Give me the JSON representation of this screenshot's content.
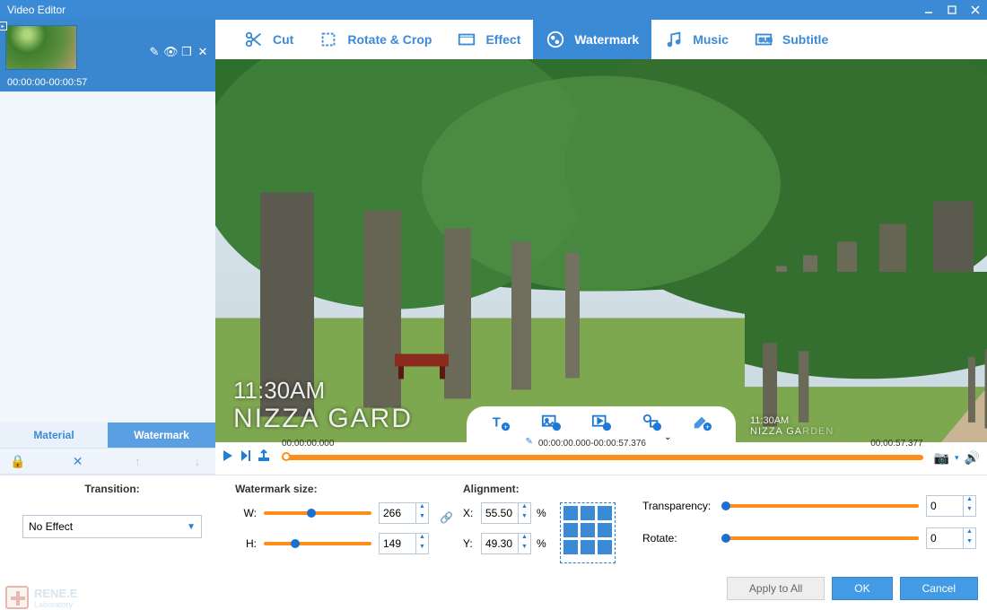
{
  "window": {
    "title": "Video Editor"
  },
  "clip": {
    "time": "00:00:00-00:00:57"
  },
  "sidebarTabs": {
    "material": "Material",
    "watermark": "Watermark"
  },
  "toolTabs": {
    "cut": "Cut",
    "rotate": "Rotate & Crop",
    "effect": "Effect",
    "watermark": "Watermark",
    "music": "Music",
    "subtitle": "Subtitle"
  },
  "watermarkOverlay": {
    "line1": "11:30AM",
    "line2": "NIZZA GARD"
  },
  "timeline": {
    "left": "00:00:00.000",
    "center": "00:00:00.000-00:00:57.376",
    "right": "00:00:57.377"
  },
  "form": {
    "transitionLabel": "Transition:",
    "transitionValue": "No Effect",
    "sizeLabel": "Watermark size:",
    "W": "W:",
    "H": "H:",
    "Wval": "266",
    "Hval": "149",
    "alignLabel": "Alignment:",
    "X": "X:",
    "Y": "Y:",
    "Xval": "55.50",
    "Yval": "49.30",
    "pct": "%",
    "transp": "Transparency:",
    "transpVal": "0",
    "rotate": "Rotate:",
    "rotateVal": "0"
  },
  "buttons": {
    "apply": "Apply to All",
    "ok": "OK",
    "cancel": "Cancel"
  },
  "logo": {
    "name": "RENE.E",
    "sub": "Laboratory"
  }
}
